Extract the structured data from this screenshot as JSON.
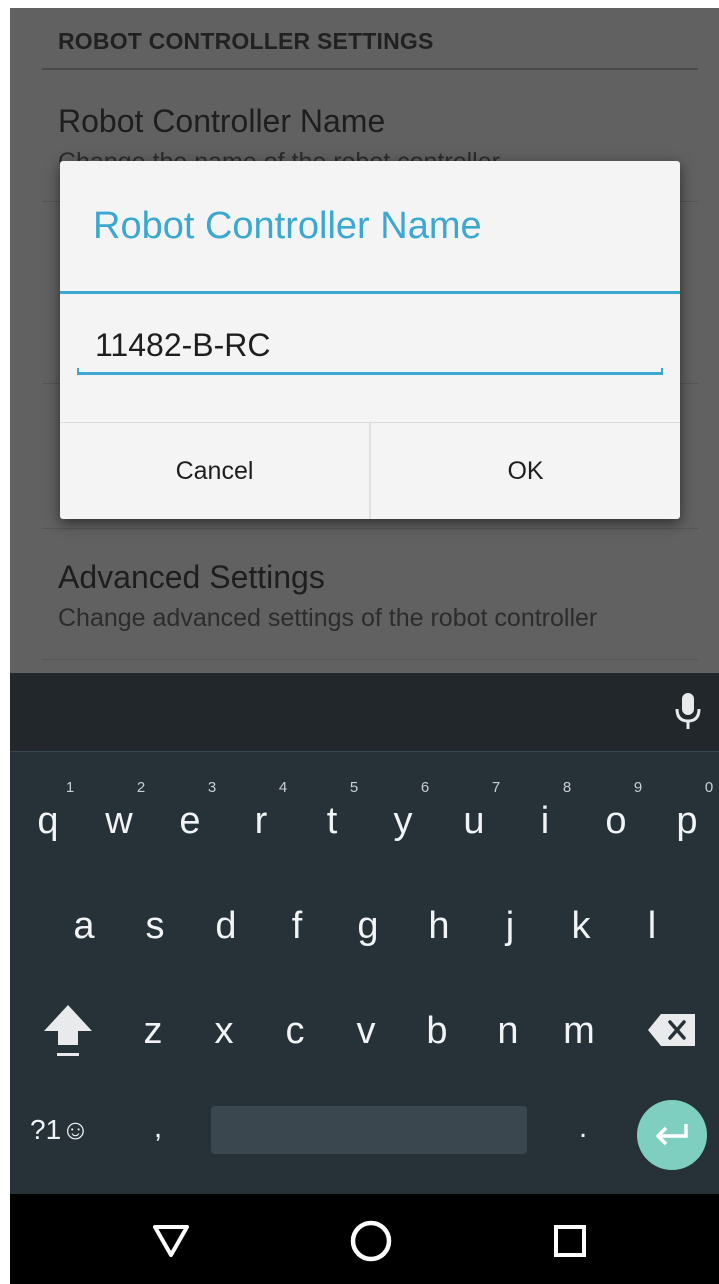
{
  "settings": {
    "section_header": "ROBOT CONTROLLER SETTINGS",
    "items": [
      {
        "title": "Robot Controller Name",
        "subtitle": "Change the name of the robot controller"
      },
      {
        "title": "Advanced Settings",
        "subtitle": "Change advanced settings of the robot controller"
      }
    ]
  },
  "dialog": {
    "title": "Robot Controller Name",
    "input_value": "11482-B-RC",
    "cancel_label": "Cancel",
    "ok_label": "OK"
  },
  "keyboard": {
    "row1": [
      "q",
      "w",
      "e",
      "r",
      "t",
      "y",
      "u",
      "i",
      "o",
      "p"
    ],
    "row1_hints": [
      "1",
      "2",
      "3",
      "4",
      "5",
      "6",
      "7",
      "8",
      "9",
      "0"
    ],
    "row2": [
      "a",
      "s",
      "d",
      "f",
      "g",
      "h",
      "j",
      "k",
      "l"
    ],
    "row3": [
      "z",
      "x",
      "c",
      "v",
      "b",
      "n",
      "m"
    ],
    "symbols_label": "?1☺",
    "comma": ",",
    "period": ".",
    "icons": [
      "mic-icon",
      "shift-icon",
      "backspace-icon",
      "enter-icon"
    ]
  },
  "navbar": {
    "icons": [
      "back-icon",
      "home-icon",
      "recents-icon"
    ]
  },
  "colors": {
    "accent": "#3aa8d0",
    "keyboard_bg": "#263238",
    "enter_key": "#7ecfc0"
  }
}
